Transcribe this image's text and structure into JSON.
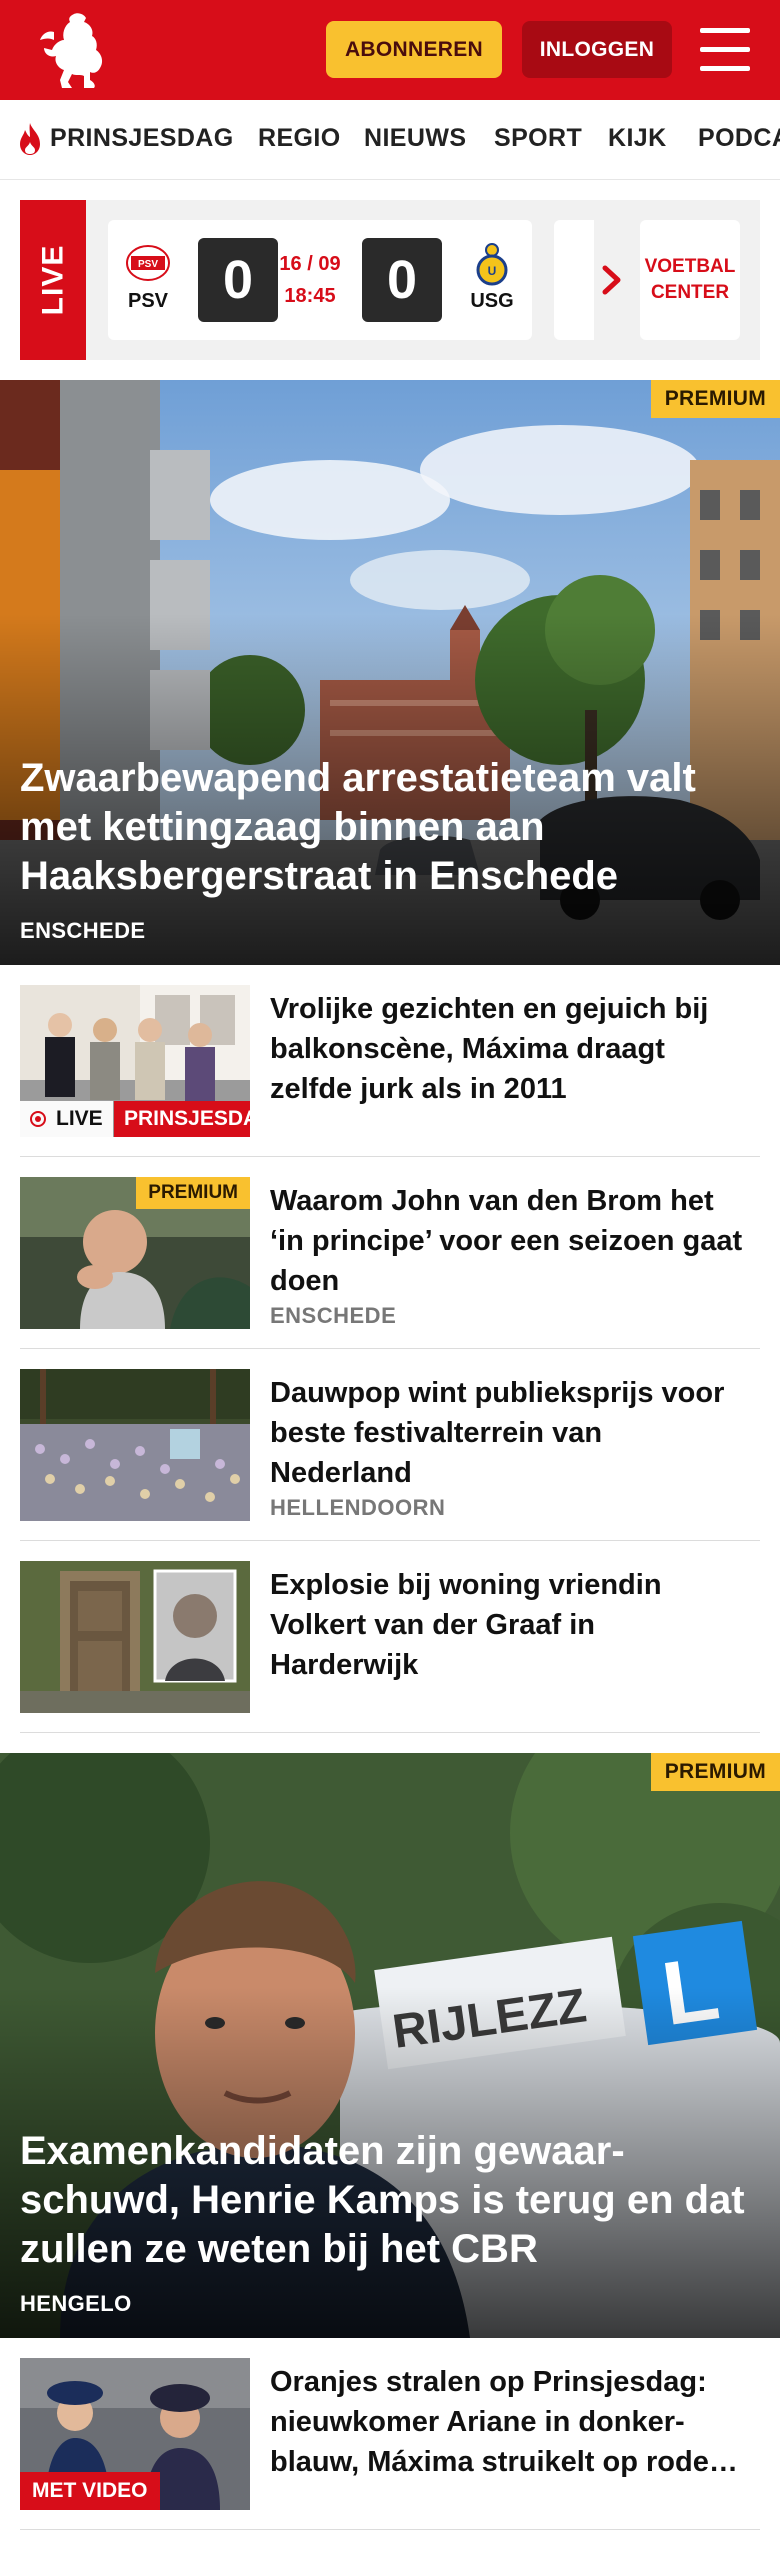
{
  "header": {
    "logo_alt": "Tubantia",
    "subscribe_label": "ABONNEREN",
    "login_label": "INLOGGEN"
  },
  "nav": {
    "items": [
      "PRINSJESDAG",
      "REGIO",
      "NIEUWS",
      "SPORT",
      "KIJK",
      "PODCA"
    ]
  },
  "livescore": {
    "live_label": "LIVE",
    "home_team": "PSV",
    "away_team": "USG",
    "home_score": "0",
    "away_score": "0",
    "date": "16 / 09",
    "time": "18:45",
    "voetbal_center": "VOETBAL CENTER"
  },
  "hero1": {
    "badge": "PREMIUM",
    "title": "Zwaarbewapend arrestatieteam valt met kettingzaag binnen aan Haaksbergerstraat in Enschede",
    "location": "ENSCHEDE"
  },
  "list1": [
    {
      "title": "Vrolijke gezichten en gejuich bij balkonscène, Máxima draagt zelfde jurk als in 2011",
      "live": "LIVE",
      "category": "PRINSJESDAG"
    },
    {
      "title": "Waarom John van den Brom het ‘in principe’ voor een seizoen gaat doen",
      "location": "ENSCHEDE",
      "badge": "PREMIUM"
    },
    {
      "title": "Dauwpop wint publieksprijs voor beste festivalterrein van Nederland",
      "location": "HELLENDOORN"
    },
    {
      "title": "Explosie bij woning vriendin Volkert van der Graaf in Harderwijk"
    }
  ],
  "hero2": {
    "badge": "PREMIUM",
    "title": "Examenkandidaten zijn gewaar­schuwd, Henrie Kamps is terug en dat zullen ze weten bij het CBR",
    "location": "HENGELO"
  },
  "list2": [
    {
      "title": "Oranjes stralen op Prinsjesdag: nieuwkomer Ariane in donker­blauw, Máxima struikelt op rode…",
      "badge": "MET VIDEO"
    }
  ],
  "colors": {
    "brand_red": "#d70d19",
    "premium_yellow": "#f9c12f",
    "login_dark_red": "#a80a13"
  }
}
